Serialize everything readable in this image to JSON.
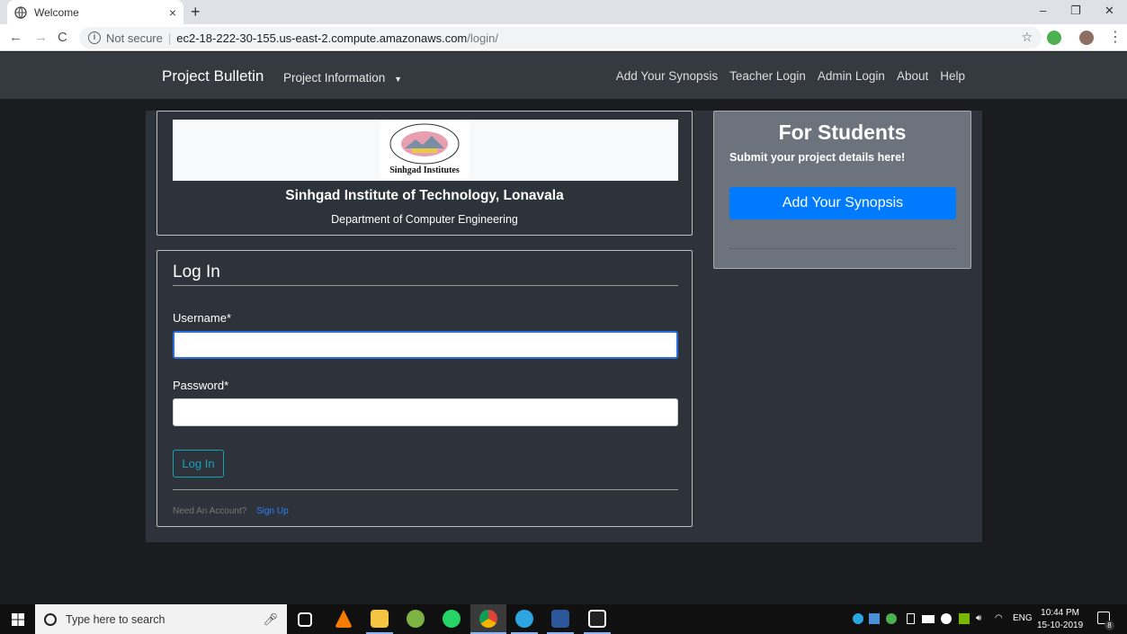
{
  "browser": {
    "tab_title": "Welcome",
    "tab_close": "×",
    "new_tab": "+",
    "security_label": "Not secure",
    "url_host": "ec2-18-222-30-155.us-east-2.compute.amazonaws.com",
    "url_path": "/login/",
    "window_controls": [
      "–",
      "❐",
      "✕"
    ],
    "nav_icons": [
      "←",
      "→",
      "C"
    ],
    "extension_colors": [
      "#4caf50",
      "#8d6e63"
    ]
  },
  "site_nav": {
    "brand": "Project Bulletin",
    "dropdown_label": "Project Information",
    "links": [
      "Add Your Synopsis",
      "Teacher Login",
      "Admin Login",
      "About",
      "Help"
    ]
  },
  "institute": {
    "logo_caption": "Sinhgad Institutes",
    "name": "Sinhgad Institute of Technology, Lonavala",
    "department": "Department of Computer Engineering"
  },
  "login": {
    "title": "Log In",
    "username_label": "Username*",
    "username_value": "",
    "password_label": "Password*",
    "password_value": "",
    "button_label": "Log In",
    "need_account": "Need An Account?",
    "signup_link": "Sign Up"
  },
  "students": {
    "title": "For Students",
    "subtitle": "Submit your project details here!",
    "button_label": "Add Your Synopsis"
  },
  "taskbar": {
    "search_placeholder": "Type here to search",
    "language": "ENG",
    "time": "10:44 PM",
    "date": "15-10-2019",
    "notification_count": "8"
  },
  "colors": {
    "navbar": "#343a40",
    "primary": "#007bff",
    "outline_info": "#17a2b8"
  }
}
